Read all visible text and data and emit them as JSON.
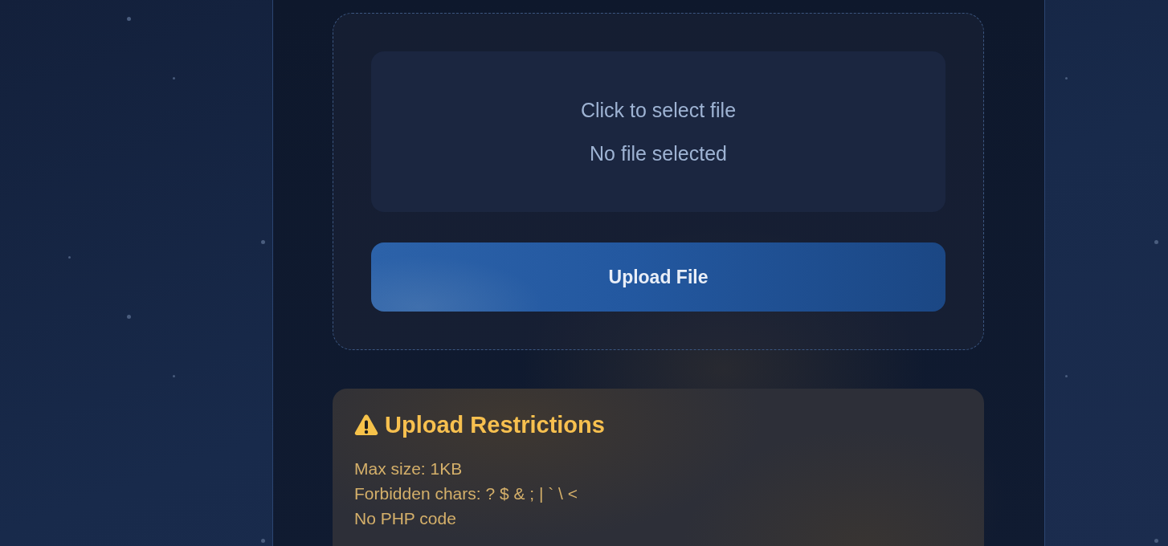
{
  "upload_card": {
    "file_picker": {
      "prompt": "Click to select file",
      "status": "No file selected"
    },
    "upload_button": {
      "label": "Upload File"
    }
  },
  "restrictions": {
    "title": "Upload Restrictions",
    "lines": [
      "Max size: 1KB",
      "Forbidden chars: ? $ & ; | ` \\ <",
      "No PHP code"
    ]
  }
}
